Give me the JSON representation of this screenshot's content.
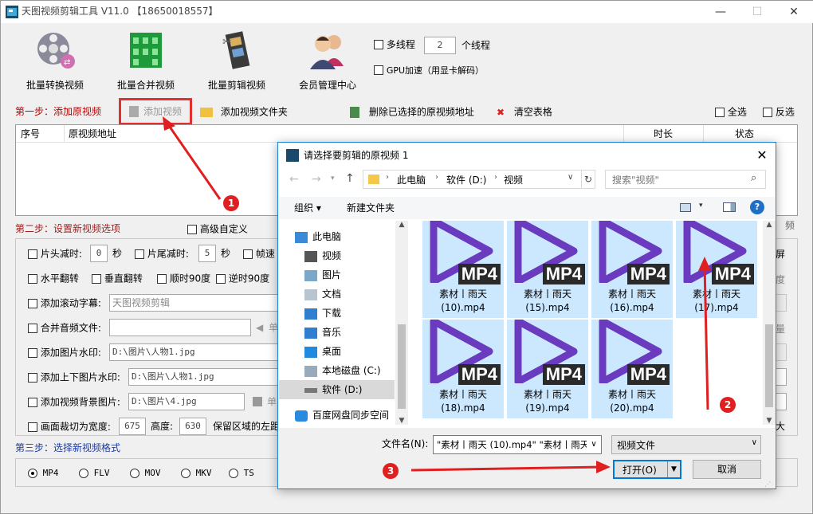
{
  "app": {
    "title": "天图视频剪辑工具 V11.0 【18650018557】",
    "win_min": "—",
    "win_max": "☐",
    "win_close": "✕"
  },
  "toolbar": {
    "items": [
      {
        "label": "批量转换视频",
        "icon": "film-reel-icon"
      },
      {
        "label": "批量合并视频",
        "icon": "green-building-icon"
      },
      {
        "label": "批量剪辑视频",
        "icon": "film-strip-icon"
      },
      {
        "label": "会员管理中心",
        "icon": "users-icon"
      }
    ],
    "multithread_label": "多线程",
    "thread_count": "2",
    "thread_unit": "个线程",
    "gpu_label": "GPU加速（用显卡解码）"
  },
  "step1": {
    "title": "第一步：添加原视频",
    "add_video": "添加视频",
    "add_folder": "添加视频文件夹",
    "delete_selected": "删除已选择的原视频地址",
    "clear_table": "清空表格",
    "select_all": "全选",
    "invert": "反选",
    "columns": [
      "序号",
      "原视频地址",
      "时长",
      "状态"
    ]
  },
  "step2": {
    "title": "第二步：设置新视频选项",
    "advanced": "高级自定义",
    "head_cut": "片头减时:",
    "head_val": "0",
    "sec1": "秒",
    "tail_cut": "片尾减时:",
    "tail_val": "5",
    "sec2": "秒",
    "frame_rate": "帧速",
    "h_flip": "水平翻转",
    "v_flip": "垂直翻转",
    "rot_cw": "顺时90度",
    "rot_ccw": "逆时90度",
    "scroll_sub": "添加滚动字幕:",
    "scroll_sub_val": "天图视频剪辑",
    "merge_audio": "合并音频文件:",
    "single1": "单",
    "img_watermark": "添加图片水印:",
    "img_watermark_val": "D:\\图片\\人物1.jpg",
    "tb_watermark": "添加上下图片水印:",
    "tb_watermark_val": "D:\\图片\\人物1.jpg",
    "bg_image": "添加视频背景图片:",
    "bg_image_val": "D:\\图片\\4.jpg",
    "single2": "单",
    "crop": "画面裁切为宽度:",
    "crop_w": "675",
    "height": "高度:",
    "crop_h": "630",
    "keep_region": "保留区域的左距",
    "right_side": [
      "频",
      "屏",
      "度",
      "量",
      "大"
    ]
  },
  "step3": {
    "title": "第三步：选择新视频格式",
    "formats": [
      "MP4",
      "FLV",
      "MOV",
      "MKV",
      "TS"
    ],
    "selected": "MP4"
  },
  "dialog": {
    "title": "请选择要剪辑的原视频 1",
    "close": "✕",
    "breadcrumb": [
      "此电脑",
      "软件 (D:)",
      "视频"
    ],
    "search_placeholder": "搜索\"视频\"",
    "organize": "组织 ▾",
    "new_folder": "新建文件夹",
    "help": "?",
    "tree": [
      {
        "label": "此电脑",
        "icon": "computer-icon"
      },
      {
        "label": "视频",
        "icon": "video-folder-icon"
      },
      {
        "label": "图片",
        "icon": "pictures-folder-icon"
      },
      {
        "label": "文档",
        "icon": "documents-folder-icon"
      },
      {
        "label": "下载",
        "icon": "download-folder-icon"
      },
      {
        "label": "音乐",
        "icon": "music-folder-icon"
      },
      {
        "label": "桌面",
        "icon": "desktop-folder-icon"
      },
      {
        "label": "本地磁盘 (C:)",
        "icon": "drive-c-icon"
      },
      {
        "label": "软件 (D:)",
        "icon": "drive-d-icon"
      },
      {
        "label": "百度网盘同步空间",
        "icon": "cloud-sync-icon"
      }
    ],
    "files": [
      {
        "line1": "素材丨雨天",
        "line2": "(10).mp4"
      },
      {
        "line1": "素材丨雨天",
        "line2": "(15).mp4"
      },
      {
        "line1": "素材丨雨天",
        "line2": "(16).mp4"
      },
      {
        "line1": "素材丨雨天",
        "line2": "(17).mp4"
      },
      {
        "line1": "素材丨雨天",
        "line2": "(18).mp4"
      },
      {
        "line1": "素材丨雨天",
        "line2": "(19).mp4"
      },
      {
        "line1": "素材丨雨天",
        "line2": "(20).mp4"
      }
    ],
    "mp4_badge": "MP4",
    "filename_label": "文件名(N):",
    "filename_value": "\"素材丨雨天 (10).mp4\" \"素材丨雨天",
    "filetype": "视频文件",
    "open": "打开(O)",
    "cancel": "取消"
  },
  "annotations": [
    "1",
    "2",
    "3"
  ],
  "colors": {
    "accent": "#1883d7",
    "selection": "#cce8ff",
    "play_purple": "#6a3bbf",
    "annotation_red": "#e02020"
  }
}
